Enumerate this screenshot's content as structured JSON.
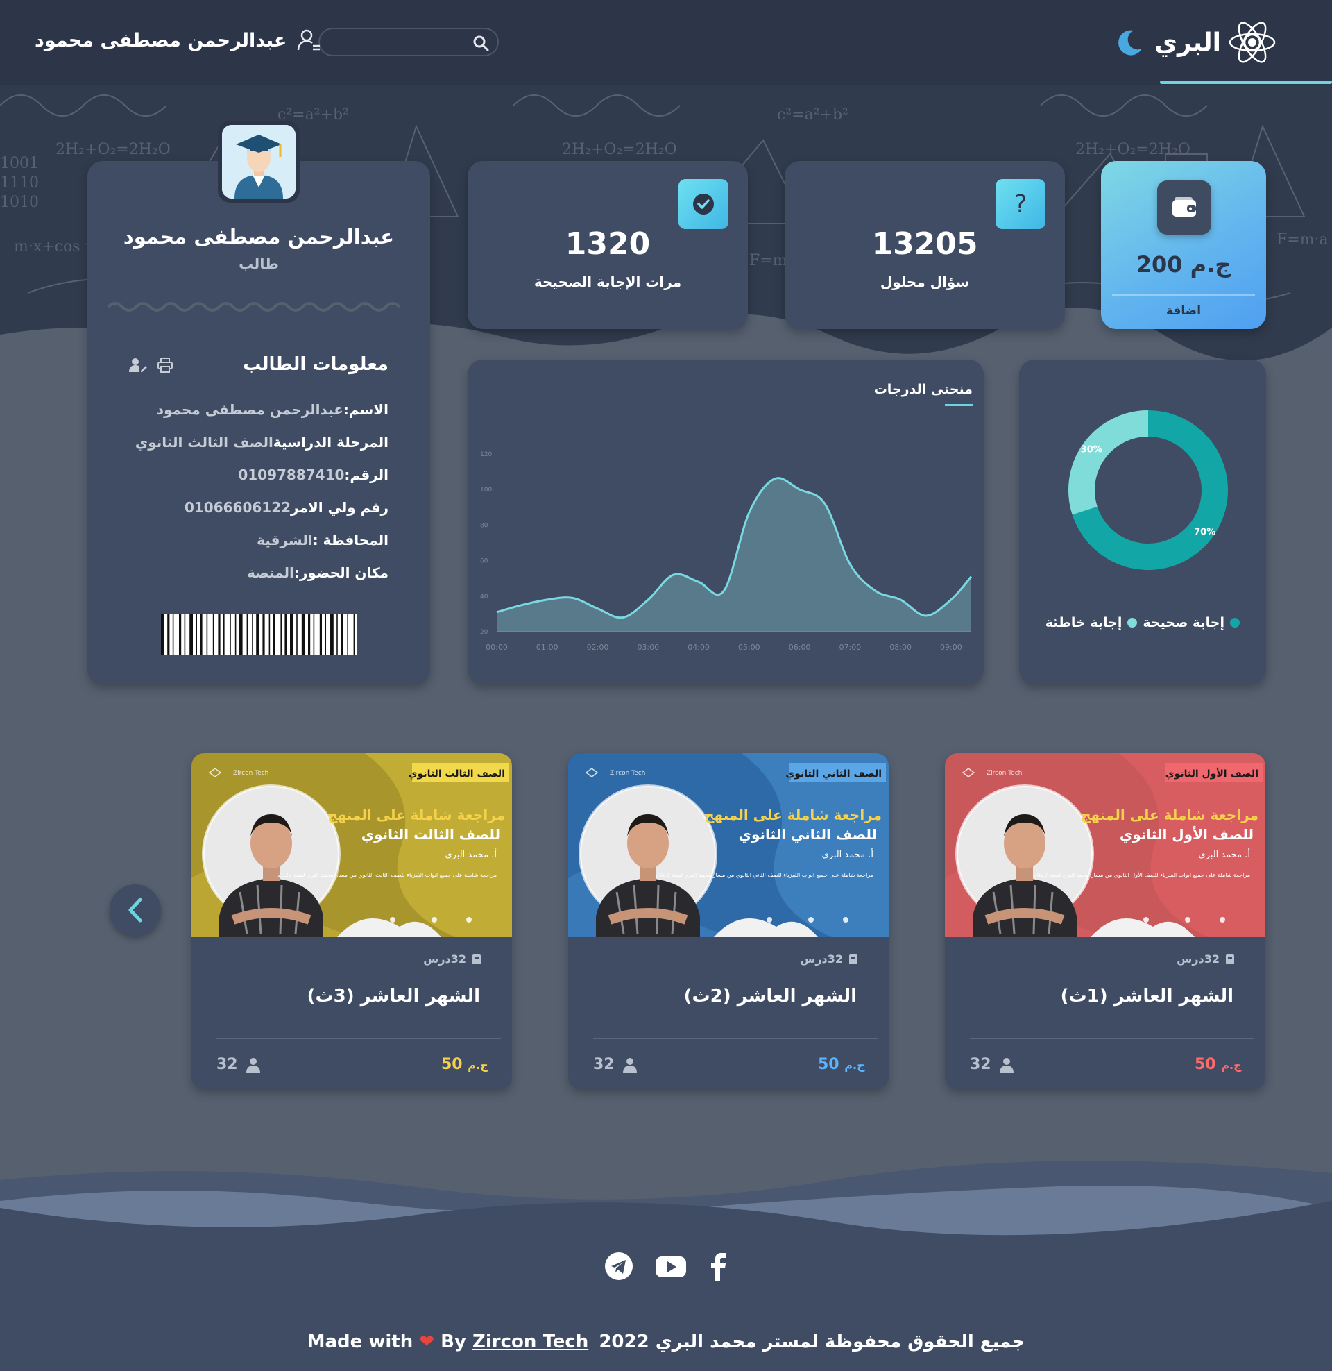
{
  "header": {
    "brand": "البري",
    "user_name": "عبدالرحمن مصطفى محمود",
    "search_placeholder": ""
  },
  "profile": {
    "name": "عبدالرحمن مصطفى محمود",
    "role": "طالب",
    "info_title": "معلومات الطالب",
    "rows": [
      {
        "key": "الاسم:",
        "value": "عبدالرحمن مصطفى محمود"
      },
      {
        "key": "المرحلة الدراسية",
        "value": "الصف الثالث الثانوي"
      },
      {
        "key": "الرقم:",
        "value": "01097887410"
      },
      {
        "key": "رقم ولي الامر",
        "value": "01066606122"
      },
      {
        "key": "المحافظة :",
        "value": "الشرقية"
      },
      {
        "key": "مكان الحضور:",
        "value": "المنصة"
      }
    ]
  },
  "stats": {
    "correct": {
      "value": "1320",
      "label": "مرات الإجابة الصحيحة"
    },
    "solved": {
      "value": "13205",
      "label": "سؤال محلول"
    },
    "wallet": {
      "amount": "200",
      "currency": "ج.م",
      "add_label": "اضافة"
    }
  },
  "chart_data": [
    {
      "type": "area",
      "title": "منحنى الدرجات",
      "x": [
        "00:00",
        "01:00",
        "02:00",
        "03:00",
        "04:00",
        "05:00",
        "06:00",
        "07:00",
        "08:00",
        "09:00"
      ],
      "y_ticks": [
        20,
        40,
        60,
        80,
        100,
        120
      ],
      "ylim": [
        20,
        120
      ],
      "points_x": [
        0,
        0.5,
        1,
        1.5,
        2,
        2.5,
        3,
        3.5,
        4,
        4.5,
        5,
        5.5,
        6,
        6.5,
        7,
        7.5,
        8,
        8.5,
        9,
        9.4
      ],
      "points_y": [
        31,
        35,
        38,
        39,
        33,
        28,
        38,
        52,
        48,
        43,
        87,
        106,
        100,
        92,
        58,
        43,
        38,
        29,
        38,
        51
      ],
      "grid": false,
      "color": "#7ad9e0"
    },
    {
      "type": "pie",
      "labels": [
        "إجابة صحيحة",
        "إجابة خاطئة"
      ],
      "values": [
        70,
        30
      ],
      "value_labels": [
        "70%",
        "30%"
      ],
      "colors": [
        "#12a7a6",
        "#7fdcd9"
      ]
    }
  ],
  "courses": [
    {
      "title": "الشهر العاشر (1ث)",
      "lessons": "32درس",
      "price": "50",
      "currency": "ج.م",
      "students": "32",
      "badge": "الصف الأول الثانوي",
      "headline": "مراجعة شاملة على المنهج",
      "grade_line": "للصف الأول الثانوي",
      "teacher": "أ. محمد البري",
      "blurb": "مراجعة شاملة على جميع ابواب الفيزياء للصف الأول الثانوي من مسار محمد البري لسنة 2022",
      "logo": "Zircon Tech",
      "bg": "#c9585b",
      "accent": "#f0686e",
      "price_color": "#ff6b6b"
    },
    {
      "title": "الشهر العاشر (2ث)",
      "lessons": "32درس",
      "price": "50",
      "currency": "ج.م",
      "students": "32",
      "badge": "الصف الثاني الثانوي",
      "headline": "مراجعة شاملة على المنهج",
      "grade_line": "للصف الثاني الثانوي",
      "teacher": "أ. محمد البري",
      "blurb": "مراجعة شاملة على جميع ابواب الفيزياء للصف الثاني الثانوي من مسار محمد البري لسنة 2022",
      "logo": "Zircon Tech",
      "bg": "#2f6aa8",
      "accent": "#5aa6e6",
      "price_color": "#5ab4ff"
    },
    {
      "title": "الشهر العاشر (3ث)",
      "lessons": "32درس",
      "price": "50",
      "currency": "ج.م",
      "students": "32",
      "badge": "الصف الثالث الثانوي",
      "headline": "مراجعة شاملة على المنهج",
      "grade_line": "للصف الثالث الثانوي",
      "teacher": "أ. محمد البري",
      "blurb": "مراجعة شاملة على جميع ابواب الفيزياء للصف الثالث الثانوي من مسار محمد البري لسنة 2022",
      "logo": "Zircon Tech",
      "bg": "#a8952b",
      "accent": "#f2d84b",
      "price_color": "#f5d14a"
    }
  ],
  "footer": {
    "copyright": "جميع الحقوق محفوظة لمستر محمد البري 2022",
    "made_with": "Made with",
    "by": "By",
    "company": "Zircon Tech",
    "heart_color": "#e8453c"
  }
}
